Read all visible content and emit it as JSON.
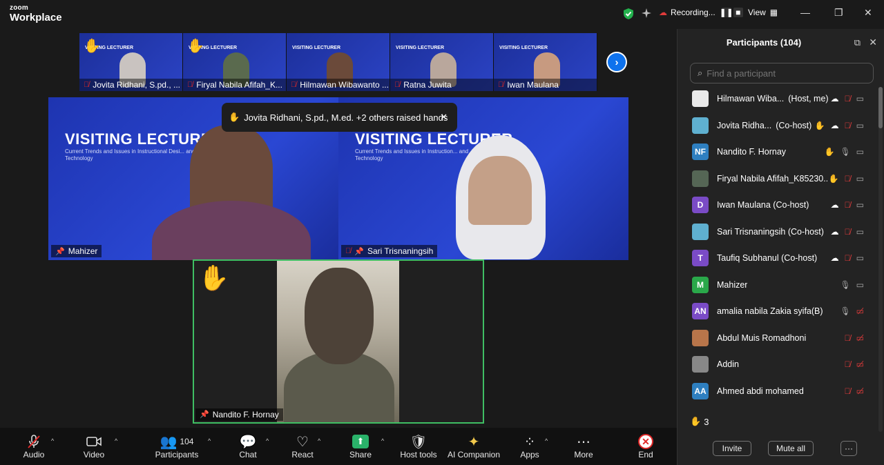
{
  "app": {
    "logo_top": "zoom",
    "logo_bottom": "Workplace"
  },
  "topbar": {
    "recording_label": "Recording...",
    "view_label": "View"
  },
  "thumbnails": [
    {
      "name": "Jovita Ridhani, S.pd., ...",
      "hand": true
    },
    {
      "name": "Firyal Nabila Afifah_K...",
      "hand": true
    },
    {
      "name": "Hilmawan Wibawanto ...",
      "hand": false
    },
    {
      "name": "Ratna Juwita",
      "hand": false
    },
    {
      "name": "Iwan Maulana",
      "hand": false
    }
  ],
  "thumb_banner": {
    "title": "VISITING LECTURER"
  },
  "notification": {
    "text": "Jovita Ridhani, S.pd., M.ed. +2 others raised hands"
  },
  "tiles": {
    "left": {
      "name": "Mahizer",
      "banner": "VISITING LECTURER",
      "sub": "Current Trends and Issues in Instructional Desi... and Technology"
    },
    "right": {
      "name": "Sari Trisnaningsih",
      "banner": "VISITING LECTURER",
      "sub": "Current Trends and Issues in Instruction... and Technology"
    },
    "bottom": {
      "name": "Nandito F. Hornay"
    }
  },
  "toolbar": {
    "audio": "Audio",
    "video": "Video",
    "participants": "Participants",
    "participants_count": "104",
    "chat": "Chat",
    "react": "React",
    "share": "Share",
    "host_tools": "Host tools",
    "ai": "AI Companion",
    "apps": "Apps",
    "more": "More",
    "end": "End"
  },
  "panel": {
    "title": "Participants (104)",
    "search_placeholder": "Find a participant",
    "participants": [
      {
        "name": "Hilmawan Wiba...",
        "role": "(Host, me)",
        "initials": "",
        "color": "#e9e9e9",
        "hand": false,
        "cloud": true,
        "mic": "off",
        "cam": "on"
      },
      {
        "name": "Jovita Ridha...",
        "role": "(Co-host)",
        "initials": "",
        "color": "#5fb0d0",
        "hand": true,
        "cloud": true,
        "mic": "off",
        "cam": "on"
      },
      {
        "name": "Nandito F. Hornay",
        "role": "",
        "initials": "NF",
        "color": "#2e7fc0",
        "hand": true,
        "cloud": false,
        "mic": "on",
        "cam": "on"
      },
      {
        "name": "Firyal Nabila Afifah_K85230...",
        "role": "",
        "initials": "",
        "color": "#556655",
        "hand": true,
        "cloud": false,
        "mic": "off",
        "cam": "on"
      },
      {
        "name": "Iwan Maulana (Co-host)",
        "role": "",
        "initials": "D",
        "color": "#7a4bc6",
        "hand": false,
        "cloud": true,
        "mic": "off",
        "cam": "on"
      },
      {
        "name": "Sari Trisnaningsih (Co-host)",
        "role": "",
        "initials": "",
        "color": "#5fb0d0",
        "hand": false,
        "cloud": true,
        "mic": "off",
        "cam": "on"
      },
      {
        "name": "Taufiq Subhanul (Co-host)",
        "role": "",
        "initials": "T",
        "color": "#7a4bc6",
        "hand": false,
        "cloud": true,
        "mic": "off",
        "cam": "on"
      },
      {
        "name": "Mahizer",
        "role": "",
        "initials": "M",
        "color": "#2aa84a",
        "hand": false,
        "cloud": false,
        "mic": "on",
        "cam": "on"
      },
      {
        "name": "amalia nabila Zakia syifa(B)",
        "role": "",
        "initials": "AN",
        "color": "#7a4bc6",
        "hand": false,
        "cloud": false,
        "mic": "on",
        "cam": "off"
      },
      {
        "name": "Abdul Muis Romadhoni",
        "role": "",
        "initials": "",
        "color": "#b8754a",
        "hand": false,
        "cloud": false,
        "mic": "off",
        "cam": "off"
      },
      {
        "name": "Addin",
        "role": "",
        "initials": "",
        "color": "#888888",
        "hand": false,
        "cloud": false,
        "mic": "off",
        "cam": "off"
      },
      {
        "name": "Ahmed abdi mohamed",
        "role": "",
        "initials": "AA",
        "color": "#2e7fc0",
        "hand": false,
        "cloud": false,
        "mic": "off",
        "cam": "off"
      }
    ],
    "raised_count": "3",
    "invite": "Invite",
    "mute_all": "Mute all",
    "more": "···"
  },
  "colors": {
    "accent": "#0e72ed",
    "active_border": "#3fbf63",
    "muted_red": "#e02828",
    "banner_blue": "#2a47d3"
  }
}
